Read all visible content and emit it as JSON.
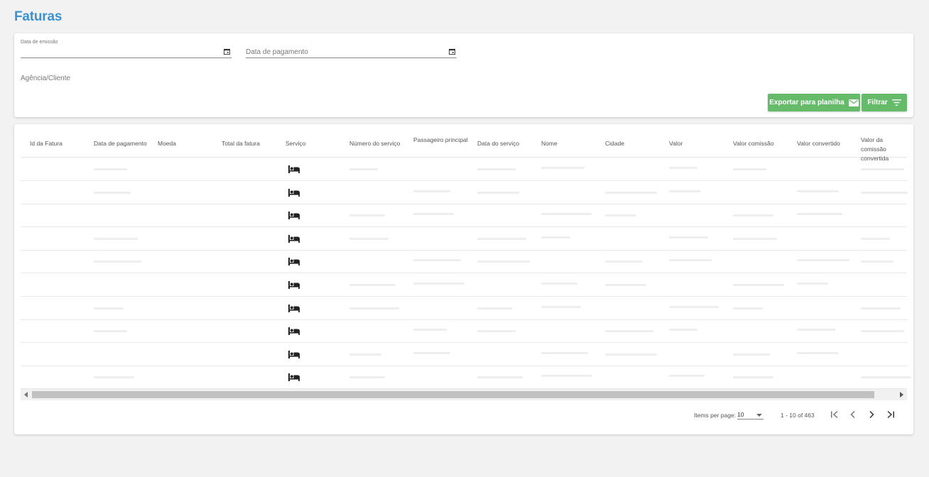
{
  "page": {
    "title": "Faturas"
  },
  "filters": {
    "data_emissao_label": "Data de emissão",
    "data_pagamento_placeholder": "Data de pagamento",
    "agencia_label": "Agência/Cliente",
    "export_label": "Exportar para planilha",
    "filter_label": "Filtrar"
  },
  "table": {
    "columns": [
      "Id da Fatura",
      "Data de pagamento",
      "Moeda",
      "Total da fatura",
      "Serviço",
      "Número do serviço",
      "Passageiro principal",
      "Data do serviço",
      "Nome",
      "Cidade",
      "Valor",
      "Valor comissão",
      "Valor convertido",
      "Valor da comissão convertida"
    ],
    "row_service_icon": "bed-icon",
    "row_count": 10
  },
  "paginator": {
    "items_per_page_label": "Items per page:",
    "page_size": "10",
    "range_label": "1 - 10 of 463"
  },
  "colors": {
    "title": "#3a93d0",
    "button_green": "#66bb6a",
    "background": "#f2f2f2"
  }
}
